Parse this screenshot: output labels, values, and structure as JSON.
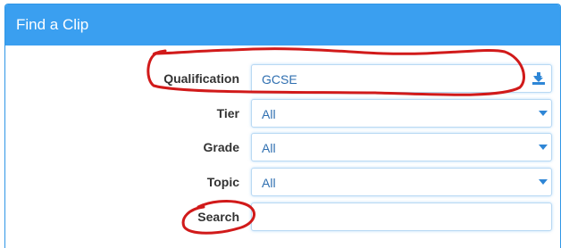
{
  "panel": {
    "title": "Find a Clip"
  },
  "filters": {
    "qualification": {
      "label": "Qualification",
      "value": "GCSE"
    },
    "tier": {
      "label": "Tier",
      "value": "All"
    },
    "grade": {
      "label": "Grade",
      "value": "All"
    },
    "topic": {
      "label": "Topic",
      "value": "All"
    },
    "search": {
      "label": "Search",
      "value": "",
      "placeholder": ""
    }
  },
  "icons": {
    "download": "download-icon",
    "dropdown": "chevron-down-icon"
  },
  "colors": {
    "header_bg": "#3a9ff0",
    "select_text": "#2f6fb0",
    "annotation_ink": "#d11a1a"
  }
}
